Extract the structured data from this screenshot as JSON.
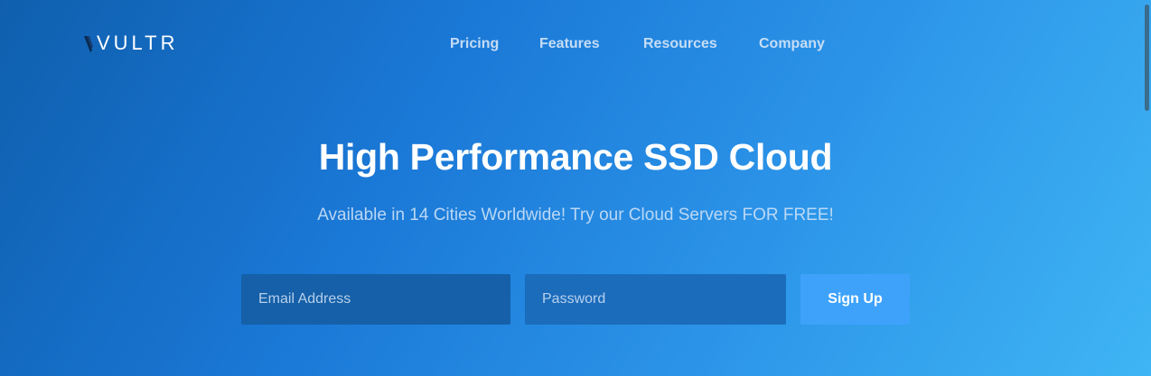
{
  "brand": {
    "logo_text": "VULTR",
    "icon": "vultr-logo-icon",
    "colors": {
      "background_start": "#0f5fae",
      "background_end": "#3fb5f4",
      "button": "#3ea2fb",
      "email_field": "#1560a8",
      "password_field": "#1c6cbc"
    }
  },
  "nav": {
    "items": [
      {
        "label": "Pricing"
      },
      {
        "label": "Features"
      },
      {
        "label": "Resources"
      },
      {
        "label": "Company"
      }
    ]
  },
  "hero": {
    "title": "High Performance SSD Cloud",
    "subtitle": "Available in 14 Cities Worldwide! Try our Cloud Servers FOR FREE!"
  },
  "signup_form": {
    "email_placeholder": "Email Address",
    "email_value": "",
    "password_placeholder": "Password",
    "password_value": "",
    "submit_label": "Sign Up"
  }
}
